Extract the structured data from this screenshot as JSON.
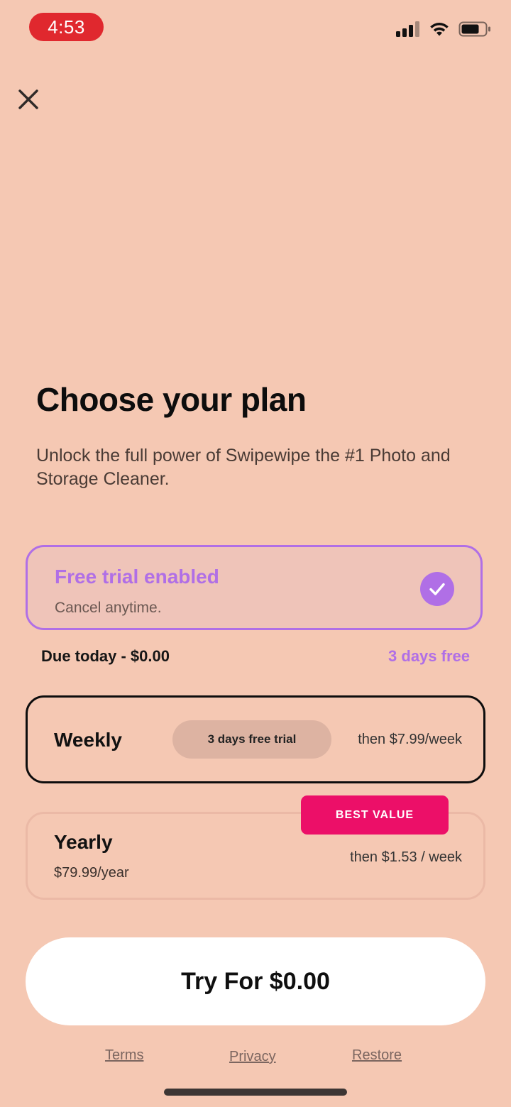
{
  "status_bar": {
    "time": "4:53"
  },
  "header": {
    "close_label": "close"
  },
  "title": "Choose your plan",
  "subtitle": "Unlock the full power of Swipewipe the #1 Photo and Storage Cleaner.",
  "trial": {
    "title": "Free trial enabled",
    "subtitle": "Cancel anytime.",
    "enabled": true
  },
  "summary": {
    "due_today": "Due today - $0.00",
    "days_free": "3 days free"
  },
  "plans": [
    {
      "name": "Weekly",
      "badge": "3 days free trial",
      "price_note": "then $7.99/week",
      "selected": true
    },
    {
      "name": "Yearly",
      "sub": "$79.99/year",
      "price_note": "then $1.53 / week",
      "tag": "BEST VALUE",
      "selected": false
    }
  ],
  "cta_label": "Try For $0.00",
  "footer": {
    "terms": "Terms",
    "privacy": "Privacy",
    "restore": "Restore"
  },
  "colors": {
    "background": "#f5c8b3",
    "accent_purple": "#b06fe6",
    "best_value_pink": "#ec0f68",
    "time_pill_red": "#e0282e"
  }
}
